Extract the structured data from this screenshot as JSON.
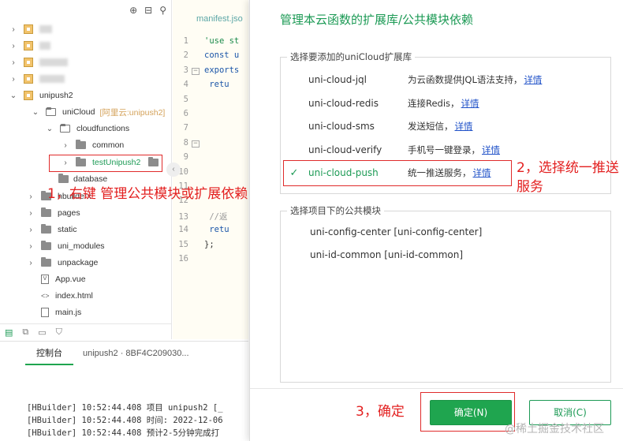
{
  "tree": {
    "toolbar_icons": [
      "plus-circle-icon",
      "collapse-icon",
      "filter-icon"
    ],
    "rows": [
      {
        "label": "",
        "blurred": true
      },
      {
        "label": "",
        "blurred": true
      },
      {
        "label": "",
        "blurred": true
      },
      {
        "label": "",
        "blurred": true
      },
      {
        "label": "unipush2"
      },
      {
        "label": "uniCloud",
        "tag": "[阿里云:unipush2]"
      },
      {
        "label": "cloudfunctions"
      },
      {
        "label": "common"
      },
      {
        "label": "testUnipush2"
      },
      {
        "label": "database"
      },
      {
        "label": "hbuilderx"
      },
      {
        "label": "pages"
      },
      {
        "label": "static"
      },
      {
        "label": "uni_modules"
      },
      {
        "label": "unpackage"
      },
      {
        "label": "App.vue"
      },
      {
        "label": "index.html"
      },
      {
        "label": "main.js"
      }
    ],
    "annotation": "1，右键 管理公共模块或扩展依赖"
  },
  "editor": {
    "tab": "manifest.jso",
    "lines": [
      {
        "n": "1",
        "text": "'use st",
        "cls": "str"
      },
      {
        "n": "2",
        "text": "const u",
        "cls": "kw"
      },
      {
        "n": "3",
        "text": "exports",
        "cls": "kw",
        "fold": true
      },
      {
        "n": "4",
        "text": "  retu",
        "cls": "kw"
      },
      {
        "n": "5",
        "text": ""
      },
      {
        "n": "6",
        "text": ""
      },
      {
        "n": "7",
        "text": ""
      },
      {
        "n": "8",
        "text": "",
        "fold": true
      },
      {
        "n": "9",
        "text": ""
      },
      {
        "n": "10",
        "text": ""
      },
      {
        "n": "11",
        "text": ""
      },
      {
        "n": "12",
        "text": ""
      },
      {
        "n": "13",
        "text": "  //返",
        "cls": "cmt"
      },
      {
        "n": "14",
        "text": "  retu",
        "cls": "kw"
      },
      {
        "n": "15",
        "text": "};"
      },
      {
        "n": "16",
        "text": ""
      }
    ]
  },
  "console": {
    "tabs": [
      "控制台",
      "unipush2 · 8BF4C209030..."
    ],
    "lines": [
      "[HBuilder] 10:52:44.408 项目 unipush2 [_",
      "[HBuilder] 10:52:44.408 时间: 2022-12-06",
      "[HBuilder] 10:52:44.408 预计2-5分钟完成打"
    ]
  },
  "dialog": {
    "title": "管理本云函数的扩展库/公共模块依赖",
    "ext_legend": "选择要添加的uniCloud扩展库",
    "extensions": [
      {
        "name": "uni-cloud-jql",
        "desc": "为云函数提供JQL语法支持，",
        "link": "详情",
        "checked": false
      },
      {
        "name": "uni-cloud-redis",
        "desc": "连接Redis，",
        "link": "详情",
        "checked": false
      },
      {
        "name": "uni-cloud-sms",
        "desc": "发送短信，",
        "link": "详情",
        "checked": false
      },
      {
        "name": "uni-cloud-verify",
        "desc": "手机号一键登录，",
        "link": "详情",
        "checked": false
      },
      {
        "name": "uni-cloud-push",
        "desc": "统一推送服务，",
        "link": "详情",
        "checked": true
      }
    ],
    "annotation2": "2，选择统一推送服务",
    "modules_legend": "选择项目下的公共模块",
    "modules": [
      "uni-config-center [uni-config-center]",
      "uni-id-common [uni-id-common]"
    ],
    "annotation3": "3，确定",
    "ok_label": "确定(N)",
    "cancel_label": "取消(C)"
  },
  "watermark": "@稀土掘金技术社区",
  "colors": {
    "accent": "#1fa54f",
    "annotation": "#e32020",
    "link": "#1e50c8"
  }
}
